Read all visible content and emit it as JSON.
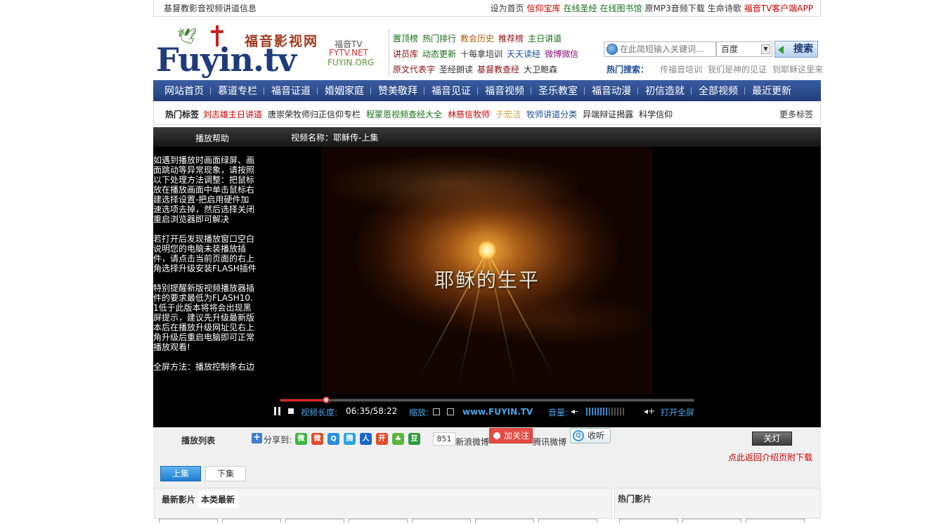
{
  "topbar": {
    "left": "基督教影音视频讲道信息",
    "links": [
      {
        "label": "设为首页",
        "color": "#333333"
      },
      {
        "label": "信仰宝库",
        "color": "#cc0000"
      },
      {
        "label": "在线圣经",
        "color": "#1a6e1a"
      },
      {
        "label": "在线图书馆",
        "color": "#1a6e1a"
      },
      {
        "label": "原MP3音频下载",
        "color": "#333333"
      },
      {
        "label": "生命诗歌",
        "color": "#333333"
      },
      {
        "label": "福音TV客户端APP",
        "color": "#cc0000"
      }
    ]
  },
  "logo": {
    "cn": "福音影视网",
    "en": "Fuyin.tv",
    "sub1": "福音TV",
    "sub2": "FYTV.NET",
    "sub3": "FUYIN.ORG"
  },
  "quick_links": [
    [
      {
        "label": "置顶榜",
        "color": "#1a6e1a"
      },
      {
        "label": "热门排行",
        "color": "#1a6e1a"
      },
      {
        "label": "教会历史",
        "color": "#b06010"
      },
      {
        "label": "推荐榜",
        "color": "#8b1010"
      },
      {
        "label": "主日讲道",
        "color": "#1a6e1a"
      }
    ],
    [
      {
        "label": "讲员库",
        "color": "#8b1010"
      },
      {
        "label": "动态更新",
        "color": "#1a6e1a"
      },
      {
        "label": "十每拿培训",
        "color": "#333333"
      },
      {
        "label": "天天读经",
        "color": "#1c4f95"
      },
      {
        "label": "微博微信",
        "color": "#8b1080"
      }
    ],
    [
      {
        "label": "原文代表字",
        "color": "#8b1010"
      },
      {
        "label": "圣经朗读",
        "color": "#333333"
      },
      {
        "label": "基督教查经",
        "color": "#8b1010"
      },
      {
        "label": "大卫鲍森",
        "color": "#333333"
      }
    ]
  ],
  "search": {
    "placeholder": "在此简短输入关键词...",
    "engine": "百度",
    "button": "搜索"
  },
  "hot_search": {
    "label": "热门搜索：",
    "items": [
      "传福音培训",
      "我们是神的见证",
      "到耶稣这里来"
    ]
  },
  "nav": [
    "网站首页",
    "慕道专栏",
    "福音证道",
    "婚姻家庭",
    "赞美敬拜",
    "福音见证",
    "福音视频",
    "圣乐教室",
    "福音动漫",
    "初信造就",
    "全部视频",
    "最近更新"
  ],
  "tags": {
    "label": "热门标签",
    "items": [
      {
        "label": "刘志雄主日讲道",
        "color": "#cc0000"
      },
      {
        "label": "唐崇荣牧师归正信仰专栏",
        "color": "#222222"
      },
      {
        "label": "程蒙恩视频查经大全",
        "color": "#1a6e1a"
      },
      {
        "label": "林慈信牧师",
        "color": "#cc0000"
      },
      {
        "label": "于宏洁",
        "color": "#d0a040"
      },
      {
        "label": "牧师讲道分类",
        "color": "#1c4f95"
      },
      {
        "label": "异端辩证揭露",
        "color": "#222222"
      },
      {
        "label": "科学信仰",
        "color": "#222222"
      }
    ],
    "more": "更多标签"
  },
  "player": {
    "help": "播放帮助",
    "title": "视频名称：耶稣传-上集",
    "side_paragraphs": [
      "如遇到播放时画面绿屏、画面跳动等异常现象，请按照以下处理方法调整：把鼠标放在播放画面中单击鼠标右建选择设置-把启用硬件加速选项去掉，然后选择关闭重启浏览器即可解决",
      "若打开后发现播放窗口空白说明您的电脑未装播放插件，请点击当前页面的右上角选择升级安装FLASH插件",
      "特别提醒新版视频播放器插件的要求最低为FLASH10.1低于此版本将将会出现黑屏提示，建议先升级最新版本后在播放升级网址见右上角升级后重启电脑即可正常播放观看!",
      "全屏方法：播放控制条右边"
    ],
    "video_caption": "耶稣的生平",
    "progress": 0.11,
    "duration_label": "视频长度:",
    "time": "06:35/58:22",
    "zoom_label": "缩放:",
    "site": "www.FUYIN.TV",
    "volume_label": "音量:",
    "volume_level": 0.55,
    "volume_bars": 14,
    "fullscreen": "打开全屏"
  },
  "below": {
    "playlist": "播放列表",
    "share_label": "分享到:",
    "share_icons": [
      {
        "name": "wechat-icon",
        "glyph": "微",
        "color": "#3db53d"
      },
      {
        "name": "weibo-icon",
        "glyph": "微",
        "color": "#e04b2b"
      },
      {
        "name": "qzone-icon",
        "glyph": "Q",
        "color": "#2d8ed8"
      },
      {
        "name": "tencent-weibo-icon",
        "glyph": "腾",
        "color": "#2aa5e0"
      },
      {
        "name": "renren-icon",
        "glyph": "人",
        "color": "#1a66c8"
      },
      {
        "name": "kaixin-icon",
        "glyph": "开",
        "color": "#e04d2a"
      },
      {
        "name": "clover-icon",
        "glyph": "♣",
        "color": "#5cb53d"
      },
      {
        "name": "douban-icon",
        "glyph": "豆",
        "color": "#2d9a3a"
      }
    ],
    "share_count": "851",
    "sina_label": "新浪微博",
    "sina_button": "加关注",
    "tencent_label": "腾讯微博",
    "tencent_button": "收听",
    "close_button": "关灯",
    "download_link": "点此返回介绍页附下载",
    "episodes": [
      {
        "label": "上集",
        "active": true
      },
      {
        "label": "下集",
        "active": false
      }
    ]
  },
  "latest": {
    "tabs": [
      {
        "label": "最新影片",
        "active": false
      },
      {
        "label": "本类最新",
        "active": true
      }
    ]
  },
  "hot_films": {
    "title": "热门影片"
  }
}
